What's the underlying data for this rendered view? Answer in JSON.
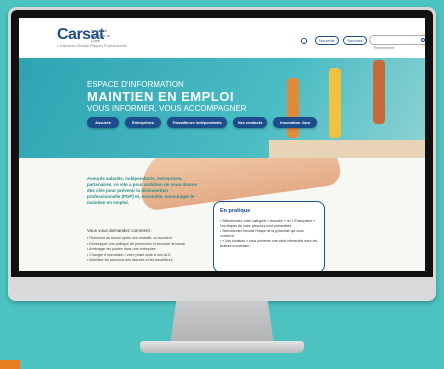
{
  "header": {
    "logo": "Carsat",
    "logo_sub": "Bretagne Pays de la Loire",
    "logo_tag": "L'Assurance Maladie Risques Professionnels",
    "buttons": [
      "Nouvelle",
      "Services"
    ],
    "search_placeholder": "Rechercher"
  },
  "hero": {
    "line1": "ESPACE D'INFORMATION",
    "line2": "MAINTIEN EN EMPLOI",
    "line3": "VOUS INFORMER, VOUS ACCOMPAGNER"
  },
  "nav": [
    "Assurés",
    "Entreprises",
    "Travailleurs indépendants",
    "Vos contacts",
    "Innovation Jura"
  ],
  "intro": "Assurés salariés, indépendants, entreprises, partenaires, ce site a pour ambition de vous donner des clés pour prévenir la désinsertion professionnelle (PDP) et, ensemble, encourager le maintien en emploi.",
  "demand_label": "Vous vous demandez comment :",
  "demand_items": [
    "• Retourner au travail après une maladie, un accident",
    "• Développer une politique de prévention et favoriser le travail",
    "• Aménager les postes dans une entreprise",
    "• Changer d'orientation / votre poste suite à une ALD",
    "• Mobiliser les parcours des assurés et les travailleurs"
  ],
  "practice": {
    "title": "En pratique",
    "lines": [
      "• Sélectionnez votre catégorie « Assurés » ou « Entreprises »",
      "Les étapes de votre parcours sont présentées",
      "• Sélectionnez ensuite l'étape de la pyramide qui vous concerne",
      "• « Vos contacts » vous présente une carte interactive avec les acteurs à mobiliser"
    ]
  }
}
